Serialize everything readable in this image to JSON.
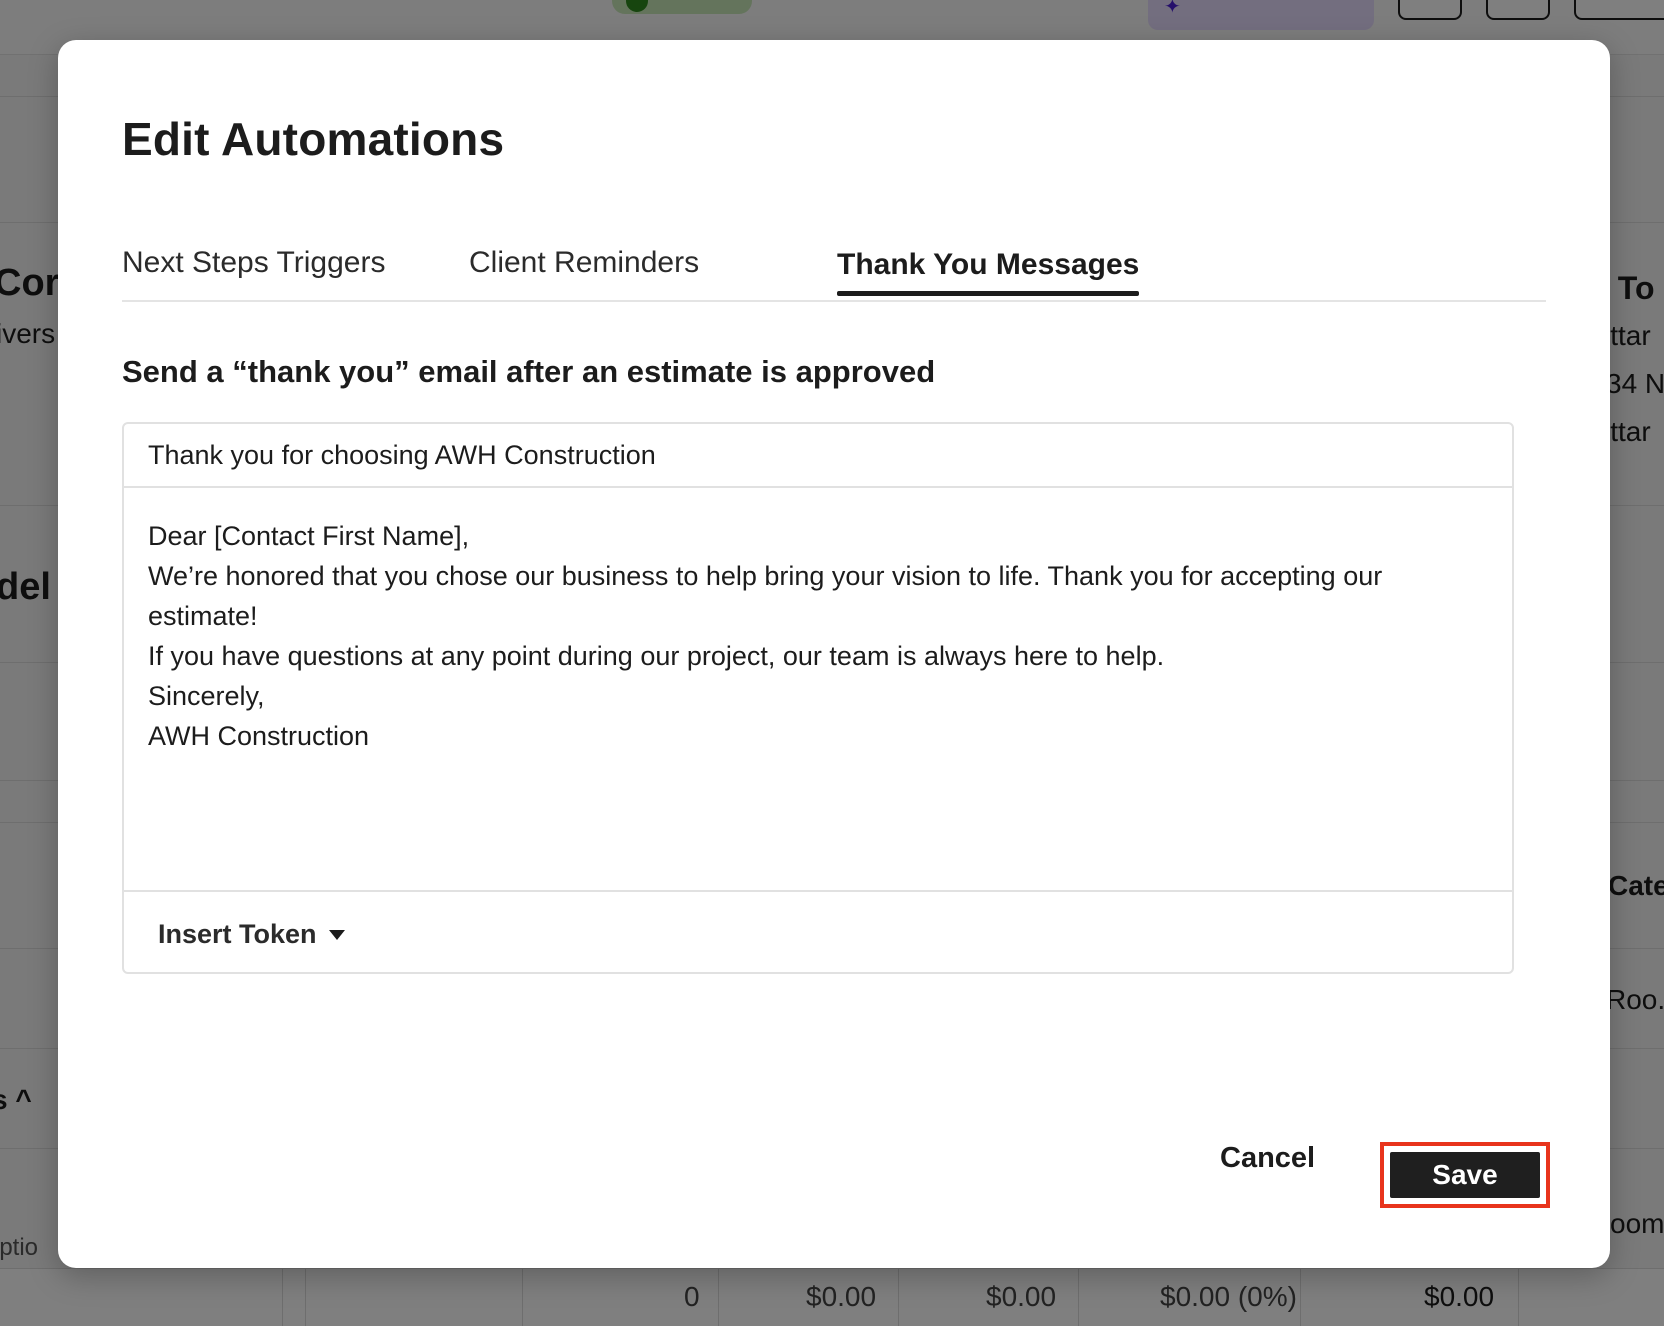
{
  "background": {
    "fragments": {
      "con": "Cor",
      "ivers": "ivers",
      "del": "del",
      "s_caret": "s ^",
      "total": "l To",
      "itta1": "ittar",
      "n34": "34 N",
      "itta2": "ittar",
      "cate": "Cate",
      "roo": "Roo.",
      "oom": "oom",
      "iptio": "iptio"
    },
    "footer_values": [
      "0",
      "$0.00",
      "$0.00",
      "$0.00 (0%)",
      "$0.00"
    ]
  },
  "modal": {
    "title": "Edit Automations",
    "tabs": [
      {
        "label": "Next Steps Triggers",
        "active": false
      },
      {
        "label": "Client Reminders",
        "active": false
      },
      {
        "label": "Thank You Messages",
        "active": true
      }
    ],
    "section_heading": "Send a “thank you” email after an estimate is approved",
    "subject_value": "Thank you for choosing AWH Construction",
    "body_lines": [
      "Dear [Contact First Name],",
      "We’re honored that you chose our business to help bring your vision to life. Thank you for accepting our",
      "estimate!",
      "If you have questions at any point during our project, our team is always here to help.",
      "Sincerely,",
      "AWH Construction"
    ],
    "insert_token_label": "Insert Token",
    "cancel_label": "Cancel",
    "save_label": "Save"
  },
  "colors": {
    "save_background": "#1f1f1f",
    "save_highlight_border": "#e8341c",
    "overlay": "rgba(0,0,0,0.5)"
  },
  "icons": {
    "insert_token_caret": "caret-down-icon"
  }
}
